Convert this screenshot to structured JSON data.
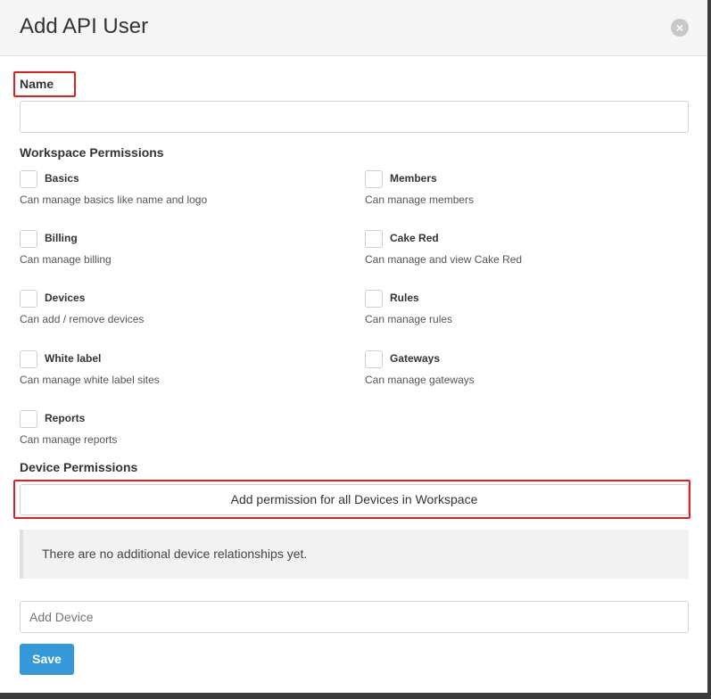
{
  "dialog": {
    "title": "Add API User",
    "close_glyph": "×"
  },
  "name_section": {
    "label": "Name",
    "value": "",
    "placeholder": ""
  },
  "workspace_permissions": {
    "heading": "Workspace Permissions",
    "items": [
      {
        "title": "Basics",
        "description": "Can manage basics like name and logo",
        "checked": false
      },
      {
        "title": "Members",
        "description": "Can manage members",
        "checked": false
      },
      {
        "title": "Billing",
        "description": "Can manage billing",
        "checked": false
      },
      {
        "title": "Cake Red",
        "description": "Can manage and view Cake Red",
        "checked": false
      },
      {
        "title": "Devices",
        "description": "Can add / remove devices",
        "checked": false
      },
      {
        "title": "Rules",
        "description": "Can manage rules",
        "checked": false
      },
      {
        "title": "White label",
        "description": "Can manage white label sites",
        "checked": false
      },
      {
        "title": "Gateways",
        "description": "Can manage gateways",
        "checked": false
      },
      {
        "title": "Reports",
        "description": "Can manage reports",
        "checked": false
      }
    ]
  },
  "device_permissions": {
    "heading": "Device Permissions",
    "add_all_label": "Add permission for all Devices in Workspace",
    "empty_notice": "There are no additional device relationships yet.",
    "add_device_placeholder": "Add Device"
  },
  "footer": {
    "save_label": "Save"
  },
  "colors": {
    "primary": "#3498db",
    "highlight": "#e0201f"
  }
}
